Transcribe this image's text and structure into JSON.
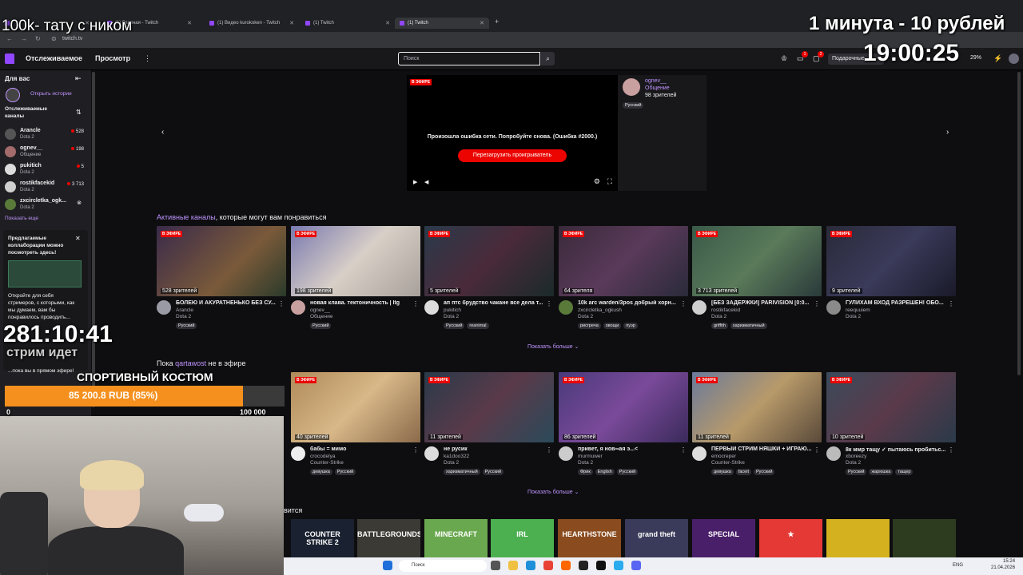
{
  "browser": {
    "tabs": [
      {
        "label": ""
      },
      {
        "label": "(1) Главная - Twitch"
      },
      {
        "label": "(1) Видео kurokoken - Twitch"
      },
      {
        "label": "(1) Twitch"
      },
      {
        "label": "(1) Twitch"
      }
    ],
    "new_tab": "+",
    "url": "twitch.tv"
  },
  "topnav": {
    "following": "Отслеживаемое",
    "browse": "Просмотр",
    "more": "⋮",
    "search_placeholder": "Поиск",
    "prime_label": "Подарочные",
    "battery": "29%",
    "badge_1": "1",
    "badge_2": "2"
  },
  "sidebar": {
    "for_you": "Для вас",
    "open_stories": "Открыть истории",
    "followed_channels": "Отслеживаемые каналы",
    "channels": [
      {
        "name": "Arancle",
        "game": "Dota 2",
        "viewers": "528"
      },
      {
        "name": "ognev__",
        "game": "Общение",
        "viewers": "198"
      },
      {
        "name": "pukitich",
        "game": "Dota 2",
        "viewers": "5"
      },
      {
        "name": "rostikfacekid",
        "game": "Dota 2",
        "viewers": "3 713"
      },
      {
        "name": "zxcircletka_ogk...",
        "game": "Dota 2",
        "viewers": ""
      }
    ],
    "show_more": "Показать еще",
    "collab": {
      "title": "Предлагаемые коллаборации можно посмотреть здесь!",
      "body": "Откройте для себя стримеров, с которыми, как мы думаем, вам бы понравилось проводить...",
      "footer": "...пока вы в прямом эфире!"
    }
  },
  "featured": {
    "live": "В ЭФИРЕ",
    "error": "Произошла ошибка сети. Попробуйте снова. (Ошибка #2000.)",
    "reload": "Перезагрузить проигрыватель",
    "channel": "ognev__",
    "category": "Общение",
    "viewers": "98 зрителей",
    "tag": "Русский"
  },
  "section1": {
    "title_highlight": "Активные каналы",
    "title_rest": ", которые могут вам понравиться",
    "show_more": "Показать больше ⌄",
    "cards": [
      {
        "viewers": "528 зрителей",
        "title": "БОЛЕЮ И АКУРАТНЕНЬКО БЕЗ СУ...",
        "name": "Arancle",
        "game": "Dota 2",
        "tags": [
          "Русский"
        ]
      },
      {
        "viewers": "198 зрителей",
        "title": "новая клава. тектоничность | ltg",
        "name": "ognev__",
        "game": "Общение",
        "tags": [
          "Русский"
        ]
      },
      {
        "viewers": "5 зрителей",
        "title": "ап птс брудство чакане все дела т...",
        "name": "pukitich",
        "game": "Dota 2",
        "tags": [
          "Русский",
          "reanimal"
        ]
      },
      {
        "viewers": "64 зрителя",
        "title": "10k arc warden/3pos добрый хорн...",
        "name": "zxcircletka_ogkush",
        "game": "Dota 2",
        "tags": [
          "рисгреча",
          "овощи",
          "пуэр"
        ]
      },
      {
        "viewers": "3 713 зрителей",
        "title": "[БЕЗ ЗАДЕРЖКИ] PARIVISION [0:0...",
        "name": "rostikfacekid",
        "game": "Dota 2",
        "tags": [
          "griffith",
          "харизматичный"
        ]
      },
      {
        "viewers": "9 зрителей",
        "title": "ГУЛИХАМ ВХОД РАЗРЕШЕН! ОБО...",
        "name": "reequuiem",
        "game": "Dota 2",
        "tags": []
      }
    ]
  },
  "section2": {
    "title_prefix": "Пока ",
    "title_highlight": "qartawost",
    "title_rest": " не в эфире",
    "show_more": "Показать больше ⌄",
    "cards": [
      {
        "viewers": "",
        "title": "",
        "name": "",
        "game": "",
        "tags": []
      },
      {
        "viewers": "40 зрителей",
        "title": "бабы = мимо",
        "name": "crocodelya",
        "game": "Counter-Strike",
        "tags": [
          "девушка",
          "Русский"
        ]
      },
      {
        "viewers": "11 зрителей",
        "title": "не русик",
        "name": "ka1doo322",
        "game": "Dota 2",
        "tags": [
          "харизматичный",
          "Русский"
        ]
      },
      {
        "viewers": "86 зрителей",
        "title": "привет, я нов∞ая э...<",
        "name": "murmuwer",
        "game": "Dota 2",
        "tags": [
          "Фрик",
          "English",
          "Русский"
        ]
      },
      {
        "viewers": "11 зрителей",
        "title": "ПЕРВЫЙ СТРИМ НЯШКИ + ИГРАЮ...",
        "name": "emocreper",
        "game": "Counter-Strike",
        "tags": [
          "девушка",
          "faceit",
          "Русский"
        ]
      },
      {
        "viewers": "10 зрителей",
        "title": "8к ммр тащу ✓ пытаюсь пробитьс...",
        "name": "xboreezy",
        "game": "Dota 2",
        "tags": [
          "Русский",
          "жарюшка",
          "тащер"
        ]
      }
    ]
  },
  "section3": {
    "title_fragment": "вится"
  },
  "categories": [
    {
      "label": "COUNTER STRIKE 2",
      "color": "#1a2130"
    },
    {
      "label": "BATTLEGROUNDS",
      "color": "#3b3a35"
    },
    {
      "label": "MINECRAFT",
      "color": "#6aa84f"
    },
    {
      "label": "IRL",
      "color": "#4caf50"
    },
    {
      "label": "HEARTHSTONE",
      "color": "#8a4b1e"
    },
    {
      "label": "grand theft",
      "color": "#3a3a5a"
    },
    {
      "label": "SPECIAL",
      "color": "#4a1f6a"
    },
    {
      "label": "★",
      "color": "#e53935"
    },
    {
      "label": "",
      "color": "#d4b21f"
    },
    {
      "label": "",
      "color": "#2d3b1f"
    }
  ],
  "taskbar": {
    "search": "Поиск",
    "lang": "ENG",
    "time": "15:24",
    "date": "21.04.2026"
  },
  "overlays": {
    "tattoo": "100k- тату с ником",
    "price": "1 минута - 10 рублей",
    "clock": "19:00:25",
    "timer": "281:10:41",
    "stream_status": "стрим идет",
    "goal_title": "СПОРТИВНЫЙ КОСТЮМ",
    "goal_amount": "85 200.8 RUB (85%)",
    "goal_progress": 0.85,
    "goal_start": "0",
    "goal_target": "100 000"
  }
}
